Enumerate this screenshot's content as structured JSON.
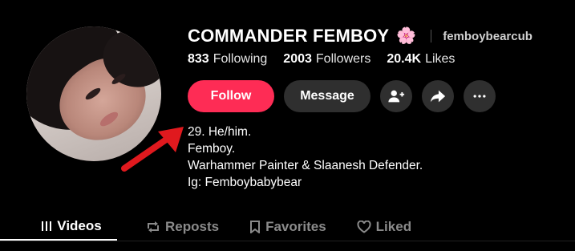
{
  "profile": {
    "display_name": "COMMANDER FEMBOY",
    "name_emoji": "🌸",
    "username": "femboybearcub",
    "avatar_icon": "profile-photo"
  },
  "stats": [
    {
      "value": "833",
      "label": "Following"
    },
    {
      "value": "2003",
      "label": "Followers"
    },
    {
      "value": "20.4K",
      "label": "Likes"
    }
  ],
  "actions": {
    "follow_label": "Follow",
    "message_label": "Message",
    "icons": [
      "add-friend-icon",
      "share-icon",
      "more-icon"
    ]
  },
  "bio": [
    "29. He/him.",
    "Femboy.",
    "Warhammer Painter & Slaanesh Defender.",
    "Ig: Femboybabybear"
  ],
  "tabs": [
    {
      "label": "Videos",
      "icon": "grid-icon",
      "active": true
    },
    {
      "label": "Reposts",
      "icon": "repost-icon",
      "active": false
    },
    {
      "label": "Favorites",
      "icon": "bookmark-icon",
      "active": false
    },
    {
      "label": "Liked",
      "icon": "heart-icon",
      "active": false
    }
  ],
  "colors": {
    "background": "#000000",
    "follow_button": "#fe2c55",
    "secondary_button": "#2f2f2f",
    "annotation_arrow": "#e0191e"
  }
}
